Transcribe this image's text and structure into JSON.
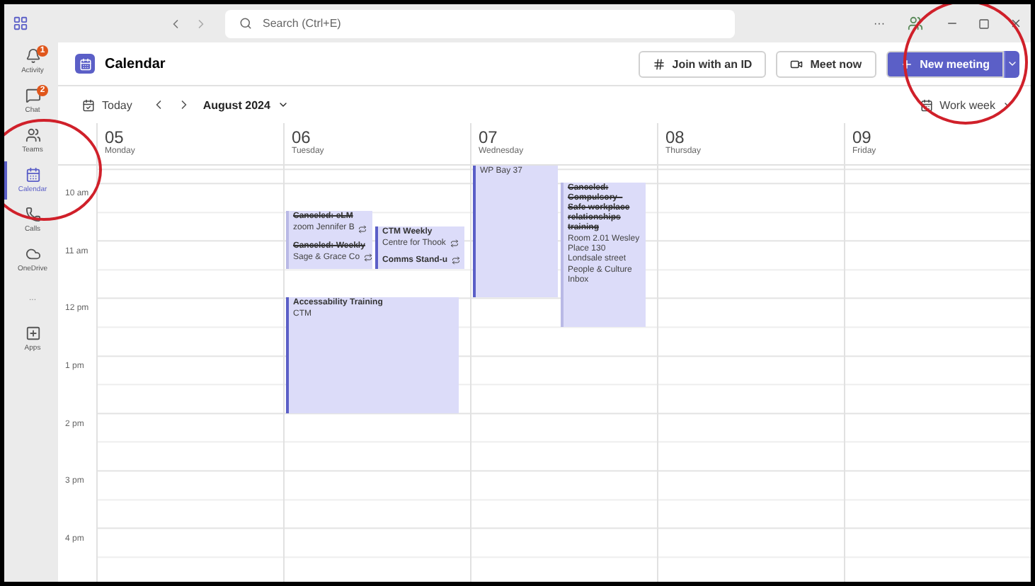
{
  "title_bar": {
    "search": {
      "placeholder": "Search (Ctrl+E)"
    },
    "more": "···"
  },
  "rail": [
    {
      "label": "Activity",
      "badge": "1",
      "selected": false
    },
    {
      "label": "Chat",
      "badge": "2",
      "selected": false
    },
    {
      "label": "Teams",
      "selected": false
    },
    {
      "label": "Calendar",
      "selected": true
    },
    {
      "label": "Calls",
      "selected": false
    },
    {
      "label": "OneDrive",
      "selected": false
    },
    {
      "label": "···",
      "selected": false
    },
    {
      "label": "Apps",
      "selected": false
    }
  ],
  "header": {
    "title": "Calendar",
    "buttons": [
      {
        "label": "Join with an ID",
        "kind": "hash"
      },
      {
        "label": "Meet now",
        "kind": "video"
      },
      {
        "label": "New meeting",
        "kind": "primary"
      }
    ]
  },
  "toolbar": {
    "today": "Today",
    "month": "August 2024",
    "view": "Work week"
  },
  "hours": [
    "10 am",
    "11 am",
    "12 pm",
    "1 pm",
    "2 pm",
    "3 pm",
    "4 pm"
  ],
  "days": [
    {
      "date": "05",
      "weekday": "Monday"
    },
    {
      "date": "06",
      "weekday": "Tuesday",
      "events": [
        {
          "title": "Canceled: eLM",
          "detail": "zoom  Jennifer B",
          "canceled": true,
          "recurring": true
        },
        {
          "title": "Canceled: Weekly",
          "detail": "Sage & Grace Co",
          "canceled": true,
          "recurring": true
        },
        {
          "title": "CTM Weekly",
          "detail": "Centre for Thook",
          "canceled": false,
          "recurring": true
        },
        {
          "title": "Comms Stand-u",
          "canceled": false,
          "recurring": true
        },
        {
          "title": "Accessability Training",
          "detail": "CTM",
          "canceled": false
        }
      ]
    },
    {
      "date": "07",
      "weekday": "Wednesday",
      "events": [
        {
          "detail": "WP Bay 37",
          "canceled": false
        },
        {
          "title": "Canceled: Compulsory - Safe workplace relationships training",
          "detail": "Room 2.01 Wesley Place 130 Londsale street",
          "organizer": "People & Culture Inbox",
          "canceled": true
        }
      ]
    },
    {
      "date": "08",
      "weekday": "Thursday"
    },
    {
      "date": "09",
      "weekday": "Friday"
    }
  ]
}
